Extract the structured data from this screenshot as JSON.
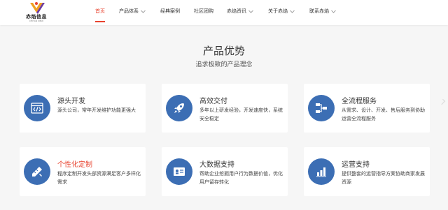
{
  "brand": {
    "name": "赤焰信息",
    "subtitle": "CHIYAN XINXI",
    "colors": {
      "accent": "#e8432f",
      "icon_bg": "#3c6eb4",
      "logo_orange": "#f0a020",
      "logo_purple": "#6b3aa0"
    }
  },
  "nav": {
    "items": [
      {
        "label": "首页",
        "active": true,
        "dropdown": false
      },
      {
        "label": "产品体系",
        "active": false,
        "dropdown": true
      },
      {
        "label": "经典案例",
        "active": false,
        "dropdown": false
      },
      {
        "label": "社区团购",
        "active": false,
        "dropdown": false
      },
      {
        "label": "赤焰资讯",
        "active": false,
        "dropdown": true
      },
      {
        "label": "关于赤焰",
        "active": false,
        "dropdown": true
      },
      {
        "label": "联系赤焰",
        "active": false,
        "dropdown": true
      }
    ]
  },
  "section": {
    "title": "产品优势",
    "subtitle": "追求极致的产品理念"
  },
  "cards": [
    {
      "title": "源头开发",
      "desc": "源头公司，常年开发维护功能更强大",
      "icon": "code-window-icon"
    },
    {
      "title": "高效交付",
      "desc": "多年以上研发经验，开发速度快，系统安全稳定",
      "icon": "rocket-icon"
    },
    {
      "title": "全流程服务",
      "desc": "从需求、设计、开发、售后服务到协助运营全流程服务",
      "icon": "flowchart-icon"
    },
    {
      "title": "个性化定制",
      "desc": "程序定制开发头部资源满足客户多样化需求",
      "icon": "pencil-ruler-icon"
    },
    {
      "title": "大数据支持",
      "desc": "帮助企业挖掘用户行为数据价值，优化用户留存转化",
      "icon": "data-card-icon"
    },
    {
      "title": "运营支持",
      "desc": "提供整套的运营指导方案协助商家发展资源",
      "icon": "bar-chart-icon"
    }
  ]
}
